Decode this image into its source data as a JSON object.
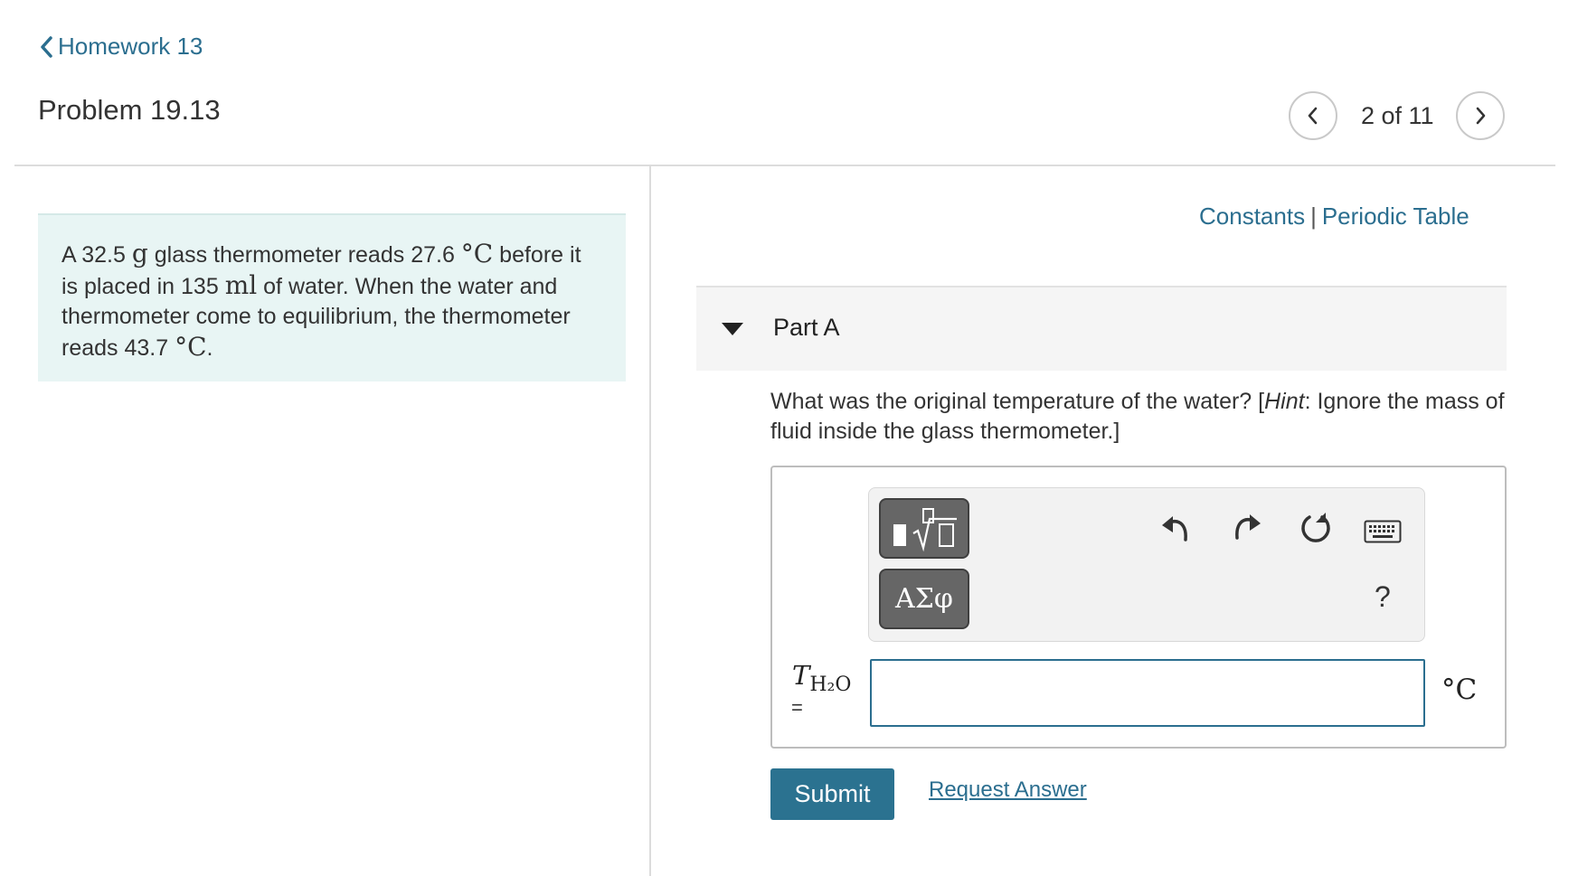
{
  "header": {
    "back_link": "Homework 13",
    "problem_title": "Problem 19.13",
    "page_counter": "2 of 11"
  },
  "problem": {
    "text_1": "A 32.5 ",
    "unit_g": "g",
    "text_2": " glass thermometer reads 27.6 ",
    "unit_c1": "°C",
    "text_3": " before it is placed in 135 ",
    "unit_ml": "ml",
    "text_4": " of water. When the water and thermometer come to equilibrium, the thermometer reads 43.7 ",
    "unit_c2": "°C",
    "text_5": "."
  },
  "resources": {
    "constants": "Constants",
    "separator": "|",
    "periodic_table": "Periodic Table"
  },
  "part": {
    "label": "Part A",
    "question_main": "What was the original temperature of the water? [",
    "hint_word": "Hint",
    "question_hint": ": Ignore the mass of fluid inside the glass thermometer.]"
  },
  "answer": {
    "variable": "T",
    "variable_sub": "H₂O",
    "equals": "=",
    "input_value": "",
    "unit": "°C",
    "greek_button": "ΑΣφ",
    "help": "?"
  },
  "actions": {
    "submit": "Submit",
    "request_answer": "Request Answer"
  },
  "colors": {
    "link": "#2b6e8f",
    "submit_bg": "#2b7290",
    "problem_bg": "#e8f5f4"
  },
  "icons": [
    "chevron-left-icon",
    "chevron-right-icon",
    "triangle-down-icon",
    "template-icon",
    "undo-icon",
    "redo-icon",
    "reset-icon",
    "keyboard-icon"
  ]
}
